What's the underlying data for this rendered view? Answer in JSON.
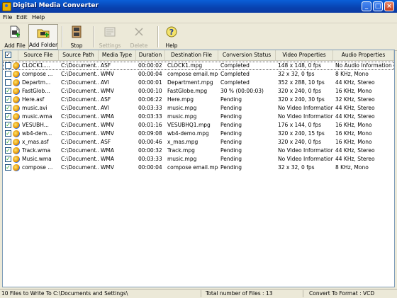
{
  "window": {
    "title": "Digital Media Converter",
    "min_glyph": "_",
    "max_glyph": "□",
    "close_glyph": "×"
  },
  "menu": [
    "File",
    "Edit",
    "Help"
  ],
  "toolbar": {
    "add_file": "Add File",
    "add_folder": "Add Folder",
    "stop": "Stop",
    "settings": "Settings",
    "delete": "Delete",
    "help": "Help"
  },
  "table": {
    "headers": [
      "Source File",
      "Source Path",
      "Media Type",
      "Duration",
      "Destination File",
      "Conversion Status",
      "Video Properties",
      "Audio Properties"
    ],
    "rows": [
      [
        "CLOCK1....",
        "C:\\Document...",
        "ASF",
        "00:00:02",
        "CLOCK1.mpg",
        "Completed",
        "148 x 148, 0 fps",
        "No Audio Information"
      ],
      [
        "compose ...",
        "C:\\Document...",
        "WMV",
        "00:00:04",
        "compose email.mpg",
        "Completed",
        "32 x 32, 0 fps",
        "8 KHz, Mono"
      ],
      [
        "Departm...",
        "C:\\Document...",
        "AVI",
        "00:00:01",
        "Department.mpg",
        "Completed",
        "352 x 288, 10 fps",
        "44 KHz, Stereo"
      ],
      [
        "FastGlob...",
        "C:\\Document...",
        "WMV",
        "00:00:10",
        "FastGlobe.mpg",
        "30 % (00:00:03)",
        "320 x 240, 0 fps",
        "16 KHz, Mono"
      ],
      [
        "Here.asf",
        "C:\\Document...",
        "ASF",
        "00:06:22",
        "Here.mpg",
        "Pending",
        "320 x 240, 30 fps",
        "32 KHz, Stereo"
      ],
      [
        "music.avi",
        "C:\\Document...",
        "AVI",
        "00:03:33",
        "music.mpg",
        "Pending",
        "No Video Information",
        "44 KHz, Stereo"
      ],
      [
        "music.wma",
        "C:\\Document...",
        "WMA",
        "00:03:33",
        "music.mpg",
        "Pending",
        "No Video Information",
        "44 KHz, Stereo"
      ],
      [
        "VESUBH...",
        "C:\\Document...",
        "WMV",
        "00:01:16",
        "VESUBHQ1.mpg",
        "Pending",
        "176 x 144, 0 fps",
        "16 KHz, Mono"
      ],
      [
        "wb4-dem...",
        "C:\\Document...",
        "WMV",
        "00:09:08",
        "wb4-demo.mpg",
        "Pending",
        "320 x 240, 15 fps",
        "16 KHz, Mono"
      ],
      [
        "x_mas.asf",
        "C:\\Document...",
        "ASF",
        "00:00:46",
        "x_mas.mpg",
        "Pending",
        "320 x 240, 0 fps",
        "16 KHz, Mono"
      ],
      [
        "Track.wma",
        "C:\\Document...",
        "WMA",
        "00:00:32",
        "Track.mpg",
        "Pending",
        "No Video Information",
        "44 KHz, Stereo"
      ],
      [
        "Music.wma",
        "C:\\Document...",
        "WMA",
        "00:03:33",
        "music.mpg",
        "Pending",
        "No Video Information",
        "44 KHz, Stereo"
      ],
      [
        "compose ...",
        "C:\\Document...",
        "WMV",
        "00:00:04",
        "compose email.mpg",
        "Pending",
        "32 x 32, 0 fps",
        "8 KHz, Mono"
      ]
    ],
    "checked": [
      false,
      false,
      false,
      true,
      true,
      true,
      true,
      true,
      true,
      true,
      true,
      true,
      true
    ]
  },
  "status": {
    "write_to": "10 Files to Write To C:\\Documents and Settings\\",
    "total": "Total number of Files : 13",
    "format": "Convert To Format : VCD"
  }
}
